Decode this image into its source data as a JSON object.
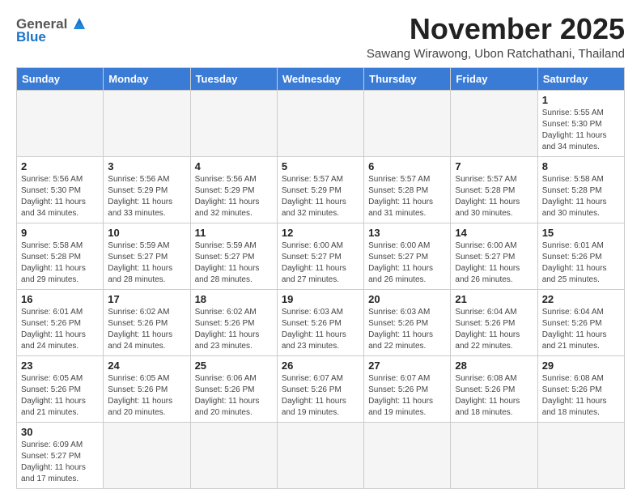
{
  "header": {
    "logo_line1": "General",
    "logo_line2": "Blue",
    "month_title": "November 2025",
    "subtitle": "Sawang Wirawong, Ubon Ratchathani, Thailand"
  },
  "weekdays": [
    "Sunday",
    "Monday",
    "Tuesday",
    "Wednesday",
    "Thursday",
    "Friday",
    "Saturday"
  ],
  "days": [
    {
      "num": "",
      "empty": true
    },
    {
      "num": "",
      "empty": true
    },
    {
      "num": "",
      "empty": true
    },
    {
      "num": "",
      "empty": true
    },
    {
      "num": "",
      "empty": true
    },
    {
      "num": "",
      "empty": true
    },
    {
      "num": "1",
      "sunrise": "Sunrise: 5:55 AM",
      "sunset": "Sunset: 5:30 PM",
      "daylight": "Daylight: 11 hours and 34 minutes."
    },
    {
      "num": "2",
      "sunrise": "Sunrise: 5:56 AM",
      "sunset": "Sunset: 5:30 PM",
      "daylight": "Daylight: 11 hours and 34 minutes."
    },
    {
      "num": "3",
      "sunrise": "Sunrise: 5:56 AM",
      "sunset": "Sunset: 5:29 PM",
      "daylight": "Daylight: 11 hours and 33 minutes."
    },
    {
      "num": "4",
      "sunrise": "Sunrise: 5:56 AM",
      "sunset": "Sunset: 5:29 PM",
      "daylight": "Daylight: 11 hours and 32 minutes."
    },
    {
      "num": "5",
      "sunrise": "Sunrise: 5:57 AM",
      "sunset": "Sunset: 5:29 PM",
      "daylight": "Daylight: 11 hours and 32 minutes."
    },
    {
      "num": "6",
      "sunrise": "Sunrise: 5:57 AM",
      "sunset": "Sunset: 5:28 PM",
      "daylight": "Daylight: 11 hours and 31 minutes."
    },
    {
      "num": "7",
      "sunrise": "Sunrise: 5:57 AM",
      "sunset": "Sunset: 5:28 PM",
      "daylight": "Daylight: 11 hours and 30 minutes."
    },
    {
      "num": "8",
      "sunrise": "Sunrise: 5:58 AM",
      "sunset": "Sunset: 5:28 PM",
      "daylight": "Daylight: 11 hours and 30 minutes."
    },
    {
      "num": "9",
      "sunrise": "Sunrise: 5:58 AM",
      "sunset": "Sunset: 5:28 PM",
      "daylight": "Daylight: 11 hours and 29 minutes."
    },
    {
      "num": "10",
      "sunrise": "Sunrise: 5:59 AM",
      "sunset": "Sunset: 5:27 PM",
      "daylight": "Daylight: 11 hours and 28 minutes."
    },
    {
      "num": "11",
      "sunrise": "Sunrise: 5:59 AM",
      "sunset": "Sunset: 5:27 PM",
      "daylight": "Daylight: 11 hours and 28 minutes."
    },
    {
      "num": "12",
      "sunrise": "Sunrise: 6:00 AM",
      "sunset": "Sunset: 5:27 PM",
      "daylight": "Daylight: 11 hours and 27 minutes."
    },
    {
      "num": "13",
      "sunrise": "Sunrise: 6:00 AM",
      "sunset": "Sunset: 5:27 PM",
      "daylight": "Daylight: 11 hours and 26 minutes."
    },
    {
      "num": "14",
      "sunrise": "Sunrise: 6:00 AM",
      "sunset": "Sunset: 5:27 PM",
      "daylight": "Daylight: 11 hours and 26 minutes."
    },
    {
      "num": "15",
      "sunrise": "Sunrise: 6:01 AM",
      "sunset": "Sunset: 5:26 PM",
      "daylight": "Daylight: 11 hours and 25 minutes."
    },
    {
      "num": "16",
      "sunrise": "Sunrise: 6:01 AM",
      "sunset": "Sunset: 5:26 PM",
      "daylight": "Daylight: 11 hours and 24 minutes."
    },
    {
      "num": "17",
      "sunrise": "Sunrise: 6:02 AM",
      "sunset": "Sunset: 5:26 PM",
      "daylight": "Daylight: 11 hours and 24 minutes."
    },
    {
      "num": "18",
      "sunrise": "Sunrise: 6:02 AM",
      "sunset": "Sunset: 5:26 PM",
      "daylight": "Daylight: 11 hours and 23 minutes."
    },
    {
      "num": "19",
      "sunrise": "Sunrise: 6:03 AM",
      "sunset": "Sunset: 5:26 PM",
      "daylight": "Daylight: 11 hours and 23 minutes."
    },
    {
      "num": "20",
      "sunrise": "Sunrise: 6:03 AM",
      "sunset": "Sunset: 5:26 PM",
      "daylight": "Daylight: 11 hours and 22 minutes."
    },
    {
      "num": "21",
      "sunrise": "Sunrise: 6:04 AM",
      "sunset": "Sunset: 5:26 PM",
      "daylight": "Daylight: 11 hours and 22 minutes."
    },
    {
      "num": "22",
      "sunrise": "Sunrise: 6:04 AM",
      "sunset": "Sunset: 5:26 PM",
      "daylight": "Daylight: 11 hours and 21 minutes."
    },
    {
      "num": "23",
      "sunrise": "Sunrise: 6:05 AM",
      "sunset": "Sunset: 5:26 PM",
      "daylight": "Daylight: 11 hours and 21 minutes."
    },
    {
      "num": "24",
      "sunrise": "Sunrise: 6:05 AM",
      "sunset": "Sunset: 5:26 PM",
      "daylight": "Daylight: 11 hours and 20 minutes."
    },
    {
      "num": "25",
      "sunrise": "Sunrise: 6:06 AM",
      "sunset": "Sunset: 5:26 PM",
      "daylight": "Daylight: 11 hours and 20 minutes."
    },
    {
      "num": "26",
      "sunrise": "Sunrise: 6:07 AM",
      "sunset": "Sunset: 5:26 PM",
      "daylight": "Daylight: 11 hours and 19 minutes."
    },
    {
      "num": "27",
      "sunrise": "Sunrise: 6:07 AM",
      "sunset": "Sunset: 5:26 PM",
      "daylight": "Daylight: 11 hours and 19 minutes."
    },
    {
      "num": "28",
      "sunrise": "Sunrise: 6:08 AM",
      "sunset": "Sunset: 5:26 PM",
      "daylight": "Daylight: 11 hours and 18 minutes."
    },
    {
      "num": "29",
      "sunrise": "Sunrise: 6:08 AM",
      "sunset": "Sunset: 5:26 PM",
      "daylight": "Daylight: 11 hours and 18 minutes."
    },
    {
      "num": "30",
      "sunrise": "Sunrise: 6:09 AM",
      "sunset": "Sunset: 5:27 PM",
      "daylight": "Daylight: 11 hours and 17 minutes."
    },
    {
      "num": "",
      "empty": true
    },
    {
      "num": "",
      "empty": true
    },
    {
      "num": "",
      "empty": true
    },
    {
      "num": "",
      "empty": true
    },
    {
      "num": "",
      "empty": true
    },
    {
      "num": "",
      "empty": true
    }
  ]
}
